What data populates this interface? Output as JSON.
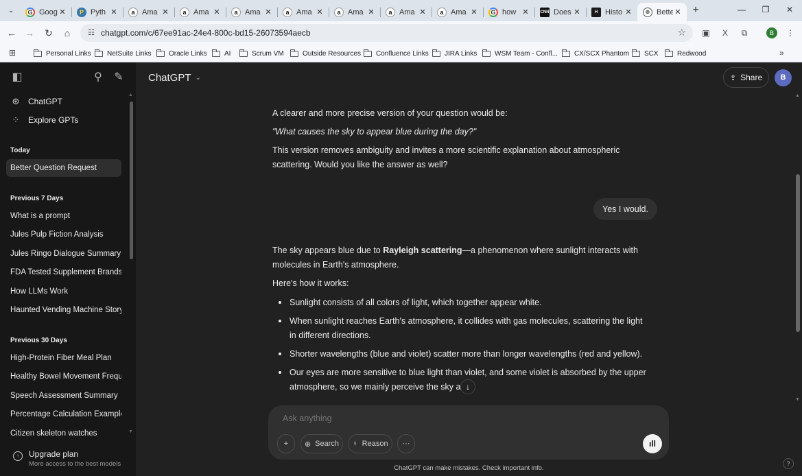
{
  "browser": {
    "tabs": [
      {
        "title": "Goog",
        "favicon": "G",
        "kind": "g"
      },
      {
        "title": "Pyth",
        "favicon": "P",
        "kind": "py"
      },
      {
        "title": "Ama",
        "favicon": "a",
        "kind": "am"
      },
      {
        "title": "Ama",
        "favicon": "a",
        "kind": "am"
      },
      {
        "title": "Ama",
        "favicon": "a",
        "kind": "am"
      },
      {
        "title": "Ama",
        "favicon": "a",
        "kind": "am"
      },
      {
        "title": "Ama",
        "favicon": "a",
        "kind": "am"
      },
      {
        "title": "Ama",
        "favicon": "a",
        "kind": "am"
      },
      {
        "title": "Ama",
        "favicon": "a",
        "kind": "am"
      },
      {
        "title": "how",
        "favicon": "G",
        "kind": "g"
      },
      {
        "title": "Does",
        "favicon": "CNN",
        "kind": "cnn"
      },
      {
        "title": "Histo",
        "favicon": "H",
        "kind": "hi"
      },
      {
        "title": "Bette",
        "favicon": "⊛",
        "kind": "gpt",
        "active": true
      }
    ],
    "url": "chatgpt.com/c/67ee91ac-24e4-800c-bd15-26073594aecb",
    "bookmarks": [
      "Personal Links",
      "NetSuite Links",
      "Oracle Links",
      "AI",
      "Scrum VM",
      "Outside Resources",
      "Confluence Links",
      "JIRA Links",
      "WSM Team - Confl...",
      "CX/SCX Phantom",
      "SCX",
      "Redwood"
    ],
    "profile_initial": "B"
  },
  "sidebar": {
    "nav": [
      {
        "label": "ChatGPT",
        "icon": "openai-icon"
      },
      {
        "label": "Explore GPTs",
        "icon": "grid-icon"
      }
    ],
    "today_label": "Today",
    "today": [
      "Better Question Request"
    ],
    "prev7_label": "Previous 7 Days",
    "prev7": [
      "What is a prompt",
      "Jules Pulp Fiction Analysis",
      "Jules Ringo Dialogue Summary",
      "FDA Tested Supplement Brands",
      "How LLMs Work",
      "Haunted Vending Machine Story"
    ],
    "prev30_label": "Previous 30 Days",
    "prev30": [
      "High-Protein Fiber Meal Plan",
      "Healthy Bowel Movement Frequency",
      "Speech Assessment Summary",
      "Percentage Calculation Example",
      "Citizen skeleton watches"
    ],
    "upgrade_title": "Upgrade plan",
    "upgrade_sub": "More access to the best models"
  },
  "header": {
    "model": "ChatGPT",
    "share": "Share",
    "avatar": "B"
  },
  "conversation": {
    "a1_p1": "A clearer and more precise version of your question would be:",
    "a1_p2": "\"What causes the sky to appear blue during the day?\"",
    "a1_p3": "This version removes ambiguity and invites a more scientific explanation about atmospheric scattering. Would you like the answer as well?",
    "user_msg": "Yes I would.",
    "a2_pre": "The sky appears blue due to ",
    "a2_bold": "Rayleigh scattering",
    "a2_post": "—a phenomenon where sunlight interacts with molecules in Earth's atmosphere.",
    "a2_intro": "Here's how it works:",
    "bullets": [
      "Sunlight consists of all colors of light, which together appear white.",
      "When sunlight reaches Earth's atmosphere, it collides with gas molecules, scattering the light in different directions.",
      "Shorter wavelengths (blue and violet) scatter more than longer wavelengths (red and yellow).",
      "Our eyes are more sensitive to blue light than violet, and some violet is absorbed by the upper atmosphere, so we mainly perceive the sky as b"
    ]
  },
  "composer": {
    "placeholder": "Ask anything",
    "search": "Search",
    "reason": "Reason",
    "disclaimer": "ChatGPT can make mistakes. Check important info."
  }
}
